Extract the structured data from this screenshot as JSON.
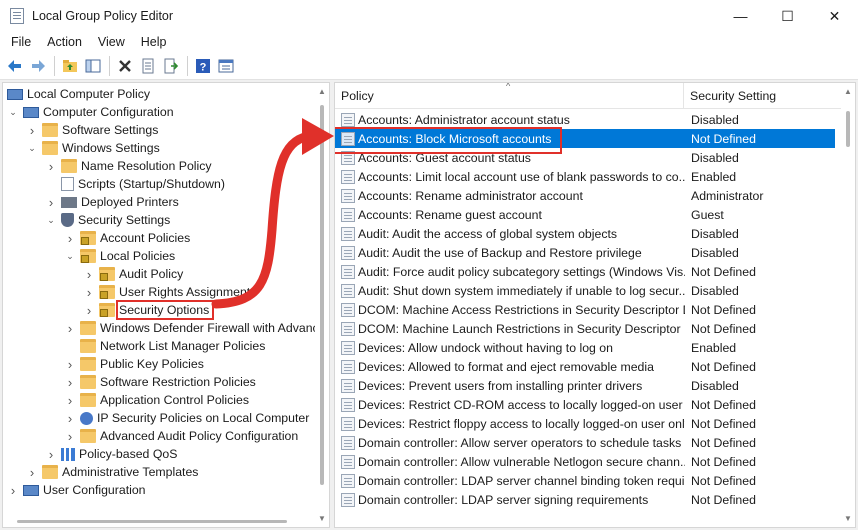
{
  "window": {
    "title": "Local Group Policy Editor",
    "minimize": "—",
    "maximize": "☐",
    "close": "✕"
  },
  "menu": [
    "File",
    "Action",
    "View",
    "Help"
  ],
  "tree": [
    {
      "label": "Local Computer Policy",
      "icon": "computer-icon",
      "chevron": "",
      "expanded": true,
      "level": 0
    },
    {
      "label": "Computer Configuration",
      "icon": "computer-icon",
      "chevron": "down",
      "level": 0
    },
    {
      "label": "Software Settings",
      "icon": "folder-icon",
      "chevron": "right",
      "level": 1
    },
    {
      "label": "Windows Settings",
      "icon": "folder-icon",
      "chevron": "down",
      "level": 1
    },
    {
      "label": "Name Resolution Policy",
      "icon": "folder-icon",
      "chevron": "right",
      "level": 2
    },
    {
      "label": "Scripts (Startup/Shutdown)",
      "icon": "script-icon",
      "chevron": "",
      "level": 2
    },
    {
      "label": "Deployed Printers",
      "icon": "printer-icon",
      "chevron": "right",
      "level": 2
    },
    {
      "label": "Security Settings",
      "icon": "security-icon",
      "chevron": "down",
      "level": 2
    },
    {
      "label": "Account Policies",
      "icon": "locked-folder-icon",
      "chevron": "right",
      "level": 3
    },
    {
      "label": "Local Policies",
      "icon": "locked-folder-icon",
      "chevron": "down",
      "level": 3
    },
    {
      "label": "Audit Policy",
      "icon": "locked-folder-icon",
      "chevron": "right",
      "level": 4
    },
    {
      "label": "User Rights Assignment",
      "icon": "locked-folder-icon",
      "chevron": "right",
      "level": 4
    },
    {
      "label": "Security Options",
      "icon": "locked-folder-icon",
      "chevron": "right",
      "level": 4,
      "selected": true
    },
    {
      "label": "Windows Defender Firewall with Advanc",
      "icon": "folder-icon",
      "chevron": "right",
      "level": 3
    },
    {
      "label": "Network List Manager Policies",
      "icon": "folder-icon",
      "chevron": "",
      "level": 3
    },
    {
      "label": "Public Key Policies",
      "icon": "folder-icon",
      "chevron": "right",
      "level": 3
    },
    {
      "label": "Software Restriction Policies",
      "icon": "folder-icon",
      "chevron": "right",
      "level": 3
    },
    {
      "label": "Application Control Policies",
      "icon": "folder-icon",
      "chevron": "right",
      "level": 3
    },
    {
      "label": "IP Security Policies on Local Computer",
      "icon": "ip-icon",
      "chevron": "right",
      "level": 3
    },
    {
      "label": "Advanced Audit Policy Configuration",
      "icon": "folder-icon",
      "chevron": "right",
      "level": 3
    },
    {
      "label": "Policy-based QoS",
      "icon": "chart-icon",
      "chevron": "right",
      "level": 2
    },
    {
      "label": "Administrative Templates",
      "icon": "folder-icon",
      "chevron": "right",
      "level": 1
    },
    {
      "label": "User Configuration",
      "icon": "computer-icon",
      "chevron": "right",
      "level": 0
    }
  ],
  "list": {
    "headers": {
      "policy": "Policy",
      "setting": "Security Setting"
    },
    "rows": [
      {
        "policy": "Accounts: Administrator account status",
        "setting": "Disabled"
      },
      {
        "policy": "Accounts: Block Microsoft accounts",
        "setting": "Not Defined",
        "selected": true
      },
      {
        "policy": "Accounts: Guest account status",
        "setting": "Disabled"
      },
      {
        "policy": "Accounts: Limit local account use of blank passwords to co...",
        "setting": "Enabled"
      },
      {
        "policy": "Accounts: Rename administrator account",
        "setting": "Administrator"
      },
      {
        "policy": "Accounts: Rename guest account",
        "setting": "Guest"
      },
      {
        "policy": "Audit: Audit the access of global system objects",
        "setting": "Disabled"
      },
      {
        "policy": "Audit: Audit the use of Backup and Restore privilege",
        "setting": "Disabled"
      },
      {
        "policy": "Audit: Force audit policy subcategory settings (Windows Vis...",
        "setting": "Not Defined"
      },
      {
        "policy": "Audit: Shut down system immediately if unable to log secur...",
        "setting": "Disabled"
      },
      {
        "policy": "DCOM: Machine Access Restrictions in Security Descriptor D...",
        "setting": "Not Defined"
      },
      {
        "policy": "DCOM: Machine Launch Restrictions in Security Descriptor ...",
        "setting": "Not Defined"
      },
      {
        "policy": "Devices: Allow undock without having to log on",
        "setting": "Enabled"
      },
      {
        "policy": "Devices: Allowed to format and eject removable media",
        "setting": "Not Defined"
      },
      {
        "policy": "Devices: Prevent users from installing printer drivers",
        "setting": "Disabled"
      },
      {
        "policy": "Devices: Restrict CD-ROM access to locally logged-on user ...",
        "setting": "Not Defined"
      },
      {
        "policy": "Devices: Restrict floppy access to locally logged-on user only",
        "setting": "Not Defined"
      },
      {
        "policy": "Domain controller: Allow server operators to schedule tasks",
        "setting": "Not Defined"
      },
      {
        "policy": "Domain controller: Allow vulnerable Netlogon secure chann...",
        "setting": "Not Defined"
      },
      {
        "policy": "Domain controller: LDAP server channel binding token requi...",
        "setting": "Not Defined"
      },
      {
        "policy": "Domain controller: LDAP server signing requirements",
        "setting": "Not Defined"
      }
    ]
  },
  "colors": {
    "selection": "#0078d7",
    "annotation": "#e0302a"
  }
}
